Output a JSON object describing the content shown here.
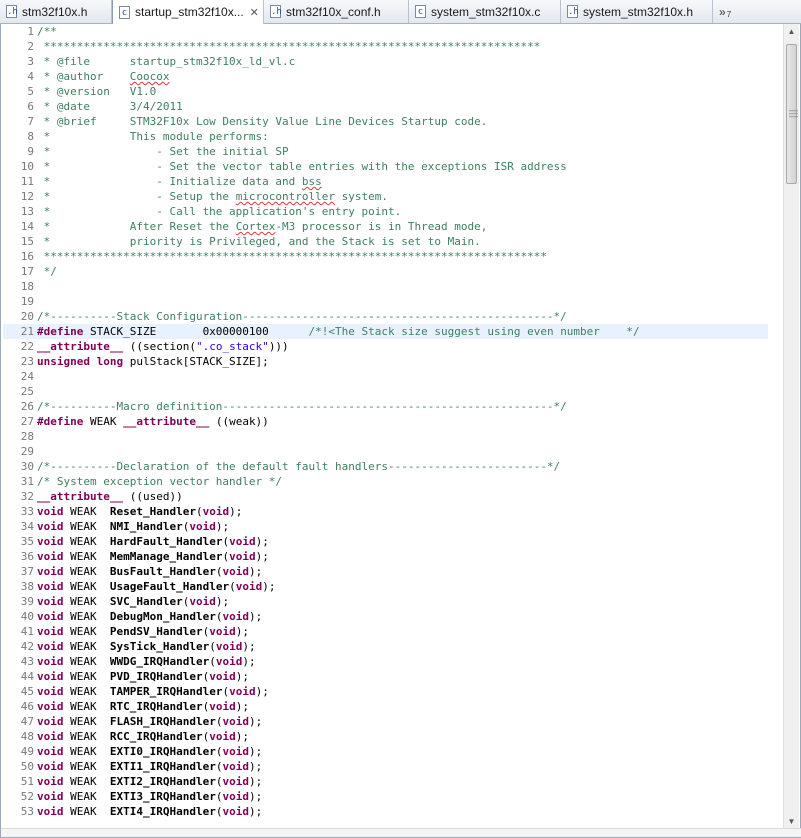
{
  "tabs": [
    {
      "label": "stm32f10x.h",
      "icon": "h-file-icon",
      "icon_glyph": ".h",
      "active": false,
      "width": 112
    },
    {
      "label": "startup_stm32f10x...",
      "icon": "c-file-icon",
      "icon_glyph": "c",
      "active": true,
      "width": 152
    },
    {
      "label": "stm32f10x_conf.h",
      "icon": "h-file-icon",
      "icon_glyph": ".h",
      "active": false,
      "width": 145
    },
    {
      "label": "system_stm32f10x.c",
      "icon": "c-file-icon",
      "icon_glyph": "c",
      "active": false,
      "width": 152
    },
    {
      "label": "system_stm32f10x.h",
      "icon": "h-file-icon",
      "icon_glyph": ".h",
      "active": false,
      "width": 152
    }
  ],
  "tab_overflow": {
    "chevron": "»",
    "count": "7"
  },
  "close_glyph": "✕",
  "highlighted_line": 21,
  "lines": [
    {
      "n": "1",
      "t": [
        [
          "c",
          "/**"
        ]
      ]
    },
    {
      "n": "2",
      "t": [
        [
          "c",
          " ***************************************************************************"
        ]
      ]
    },
    {
      "n": "3",
      "t": [
        [
          "c",
          " * @file      startup_stm32f10x_ld_vl.c"
        ]
      ]
    },
    {
      "n": "4",
      "t": [
        [
          "c",
          " * @author    "
        ],
        [
          "cs",
          "Coocox"
        ]
      ]
    },
    {
      "n": "5",
      "t": [
        [
          "c",
          " * @version   V1.0"
        ]
      ]
    },
    {
      "n": "6",
      "t": [
        [
          "c",
          " * @date      3/4/2011"
        ]
      ]
    },
    {
      "n": "7",
      "t": [
        [
          "c",
          " * @brief     STM32F10x Low Density Value Line Devices Startup code."
        ]
      ]
    },
    {
      "n": "8",
      "t": [
        [
          "c",
          " *            This module performs:"
        ]
      ]
    },
    {
      "n": "9",
      "t": [
        [
          "c",
          " *                - Set the initial SP"
        ]
      ]
    },
    {
      "n": "10",
      "t": [
        [
          "c",
          " *                - Set the vector table entries with the exceptions ISR address"
        ]
      ]
    },
    {
      "n": "11",
      "t": [
        [
          "c",
          " *                - Initialize data and "
        ],
        [
          "cs",
          "bss"
        ]
      ]
    },
    {
      "n": "12",
      "t": [
        [
          "c",
          " *                - Setup the "
        ],
        [
          "cs",
          "microcontroller"
        ],
        [
          "c",
          " system."
        ]
      ]
    },
    {
      "n": "13",
      "t": [
        [
          "c",
          " *                - Call the application's entry point."
        ]
      ]
    },
    {
      "n": "14",
      "t": [
        [
          "c",
          " *            After Reset the "
        ],
        [
          "cs",
          "Cortex"
        ],
        [
          "c",
          "-M3 processor is in Thread mode,"
        ]
      ]
    },
    {
      "n": "15",
      "t": [
        [
          "c",
          " *            priority is Privileged, and the Stack is set to Main."
        ]
      ]
    },
    {
      "n": "16",
      "t": [
        [
          "c",
          " ****************************************************************************"
        ]
      ]
    },
    {
      "n": "17",
      "t": [
        [
          "c",
          " */"
        ]
      ]
    },
    {
      "n": "18",
      "t": []
    },
    {
      "n": "19",
      "t": []
    },
    {
      "n": "20",
      "t": [
        [
          "c",
          "/*----------Stack Configuration-----------------------------------------------*/"
        ]
      ]
    },
    {
      "n": "21",
      "t": [
        [
          "k",
          "#define"
        ],
        [
          "p",
          " STACK_SIZE       0x00000100      "
        ],
        [
          "c",
          "/*!<The Stack size suggest using even number    */"
        ]
      ]
    },
    {
      "n": "22",
      "t": [
        [
          "k",
          "__attribute__"
        ],
        [
          "p",
          " ((section("
        ],
        [
          "s",
          "\".co_stack\""
        ],
        [
          "p",
          ")))"
        ]
      ]
    },
    {
      "n": "23",
      "t": [
        [
          "k",
          "unsigned long"
        ],
        [
          "p",
          " pulStack[STACK_SIZE];"
        ]
      ]
    },
    {
      "n": "24",
      "t": []
    },
    {
      "n": "25",
      "t": []
    },
    {
      "n": "26",
      "t": [
        [
          "c",
          "/*----------Macro definition--------------------------------------------------*/"
        ]
      ]
    },
    {
      "n": "27",
      "t": [
        [
          "k",
          "#define"
        ],
        [
          "p",
          " WEAK "
        ],
        [
          "k",
          "__attribute__"
        ],
        [
          "p",
          " ((weak))"
        ]
      ]
    },
    {
      "n": "28",
      "t": []
    },
    {
      "n": "29",
      "t": []
    },
    {
      "n": "30",
      "t": [
        [
          "c",
          "/*----------Declaration of the default fault handlers------------------------*/"
        ]
      ]
    },
    {
      "n": "31",
      "t": [
        [
          "c",
          "/* System exception vector handler */"
        ]
      ]
    },
    {
      "n": "32",
      "t": [
        [
          "k",
          "__attribute__"
        ],
        [
          "p",
          " ((used))"
        ]
      ]
    },
    {
      "n": "33",
      "t": [
        [
          "k",
          "void"
        ],
        [
          "p",
          " WEAK  "
        ],
        [
          "f",
          "Reset_Handler"
        ],
        [
          "p",
          "("
        ],
        [
          "k",
          "void"
        ],
        [
          "p",
          ");"
        ]
      ]
    },
    {
      "n": "34",
      "t": [
        [
          "k",
          "void"
        ],
        [
          "p",
          " WEAK  "
        ],
        [
          "f",
          "NMI_Handler"
        ],
        [
          "p",
          "("
        ],
        [
          "k",
          "void"
        ],
        [
          "p",
          ");"
        ]
      ]
    },
    {
      "n": "35",
      "t": [
        [
          "k",
          "void"
        ],
        [
          "p",
          " WEAK  "
        ],
        [
          "f",
          "HardFault_Handler"
        ],
        [
          "p",
          "("
        ],
        [
          "k",
          "void"
        ],
        [
          "p",
          ");"
        ]
      ]
    },
    {
      "n": "36",
      "t": [
        [
          "k",
          "void"
        ],
        [
          "p",
          " WEAK  "
        ],
        [
          "f",
          "MemManage_Handler"
        ],
        [
          "p",
          "("
        ],
        [
          "k",
          "void"
        ],
        [
          "p",
          ");"
        ]
      ]
    },
    {
      "n": "37",
      "t": [
        [
          "k",
          "void"
        ],
        [
          "p",
          " WEAK  "
        ],
        [
          "f",
          "BusFault_Handler"
        ],
        [
          "p",
          "("
        ],
        [
          "k",
          "void"
        ],
        [
          "p",
          ");"
        ]
      ]
    },
    {
      "n": "38",
      "t": [
        [
          "k",
          "void"
        ],
        [
          "p",
          " WEAK  "
        ],
        [
          "f",
          "UsageFault_Handler"
        ],
        [
          "p",
          "("
        ],
        [
          "k",
          "void"
        ],
        [
          "p",
          ");"
        ]
      ]
    },
    {
      "n": "39",
      "t": [
        [
          "k",
          "void"
        ],
        [
          "p",
          " WEAK  "
        ],
        [
          "f",
          "SVC_Handler"
        ],
        [
          "p",
          "("
        ],
        [
          "k",
          "void"
        ],
        [
          "p",
          ");"
        ]
      ]
    },
    {
      "n": "40",
      "t": [
        [
          "k",
          "void"
        ],
        [
          "p",
          " WEAK  "
        ],
        [
          "f",
          "DebugMon_Handler"
        ],
        [
          "p",
          "("
        ],
        [
          "k",
          "void"
        ],
        [
          "p",
          ");"
        ]
      ]
    },
    {
      "n": "41",
      "t": [
        [
          "k",
          "void"
        ],
        [
          "p",
          " WEAK  "
        ],
        [
          "f",
          "PendSV_Handler"
        ],
        [
          "p",
          "("
        ],
        [
          "k",
          "void"
        ],
        [
          "p",
          ");"
        ]
      ]
    },
    {
      "n": "42",
      "t": [
        [
          "k",
          "void"
        ],
        [
          "p",
          " WEAK  "
        ],
        [
          "f",
          "SysTick_Handler"
        ],
        [
          "p",
          "("
        ],
        [
          "k",
          "void"
        ],
        [
          "p",
          ");"
        ]
      ]
    },
    {
      "n": "43",
      "t": [
        [
          "k",
          "void"
        ],
        [
          "p",
          " WEAK  "
        ],
        [
          "f",
          "WWDG_IRQHandler"
        ],
        [
          "p",
          "("
        ],
        [
          "k",
          "void"
        ],
        [
          "p",
          ");"
        ]
      ]
    },
    {
      "n": "44",
      "t": [
        [
          "k",
          "void"
        ],
        [
          "p",
          " WEAK  "
        ],
        [
          "f",
          "PVD_IRQHandler"
        ],
        [
          "p",
          "("
        ],
        [
          "k",
          "void"
        ],
        [
          "p",
          ");"
        ]
      ]
    },
    {
      "n": "45",
      "t": [
        [
          "k",
          "void"
        ],
        [
          "p",
          " WEAK  "
        ],
        [
          "f",
          "TAMPER_IRQHandler"
        ],
        [
          "p",
          "("
        ],
        [
          "k",
          "void"
        ],
        [
          "p",
          ");"
        ]
      ]
    },
    {
      "n": "46",
      "t": [
        [
          "k",
          "void"
        ],
        [
          "p",
          " WEAK  "
        ],
        [
          "f",
          "RTC_IRQHandler"
        ],
        [
          "p",
          "("
        ],
        [
          "k",
          "void"
        ],
        [
          "p",
          ");"
        ]
      ]
    },
    {
      "n": "47",
      "t": [
        [
          "k",
          "void"
        ],
        [
          "p",
          " WEAK  "
        ],
        [
          "f",
          "FLASH_IRQHandler"
        ],
        [
          "p",
          "("
        ],
        [
          "k",
          "void"
        ],
        [
          "p",
          ");"
        ]
      ]
    },
    {
      "n": "48",
      "t": [
        [
          "k",
          "void"
        ],
        [
          "p",
          " WEAK  "
        ],
        [
          "f",
          "RCC_IRQHandler"
        ],
        [
          "p",
          "("
        ],
        [
          "k",
          "void"
        ],
        [
          "p",
          ");"
        ]
      ]
    },
    {
      "n": "49",
      "t": [
        [
          "k",
          "void"
        ],
        [
          "p",
          " WEAK  "
        ],
        [
          "f",
          "EXTI0_IRQHandler"
        ],
        [
          "p",
          "("
        ],
        [
          "k",
          "void"
        ],
        [
          "p",
          ");"
        ]
      ]
    },
    {
      "n": "50",
      "t": [
        [
          "k",
          "void"
        ],
        [
          "p",
          " WEAK  "
        ],
        [
          "f",
          "EXTI1_IRQHandler"
        ],
        [
          "p",
          "("
        ],
        [
          "k",
          "void"
        ],
        [
          "p",
          ");"
        ]
      ]
    },
    {
      "n": "51",
      "t": [
        [
          "k",
          "void"
        ],
        [
          "p",
          " WEAK  "
        ],
        [
          "f",
          "EXTI2_IRQHandler"
        ],
        [
          "p",
          "("
        ],
        [
          "k",
          "void"
        ],
        [
          "p",
          ");"
        ]
      ]
    },
    {
      "n": "52",
      "t": [
        [
          "k",
          "void"
        ],
        [
          "p",
          " WEAK  "
        ],
        [
          "f",
          "EXTI3_IRQHandler"
        ],
        [
          "p",
          "("
        ],
        [
          "k",
          "void"
        ],
        [
          "p",
          ");"
        ]
      ]
    },
    {
      "n": "53",
      "t": [
        [
          "k",
          "void"
        ],
        [
          "p",
          " WEAK  "
        ],
        [
          "f",
          "EXTI4_IRQHandler"
        ],
        [
          "p",
          "("
        ],
        [
          "k",
          "void"
        ],
        [
          "p",
          ");"
        ]
      ]
    }
  ],
  "colors": {
    "comment": "#3f7f5f",
    "keyword": "#7f0055",
    "string": "#2a00ff",
    "highlight": "#e8f2fe",
    "line_number": "#787878"
  },
  "scrollbar": {
    "up_glyph": "▲",
    "down_glyph": "▼",
    "grip_glyph": "≡"
  }
}
